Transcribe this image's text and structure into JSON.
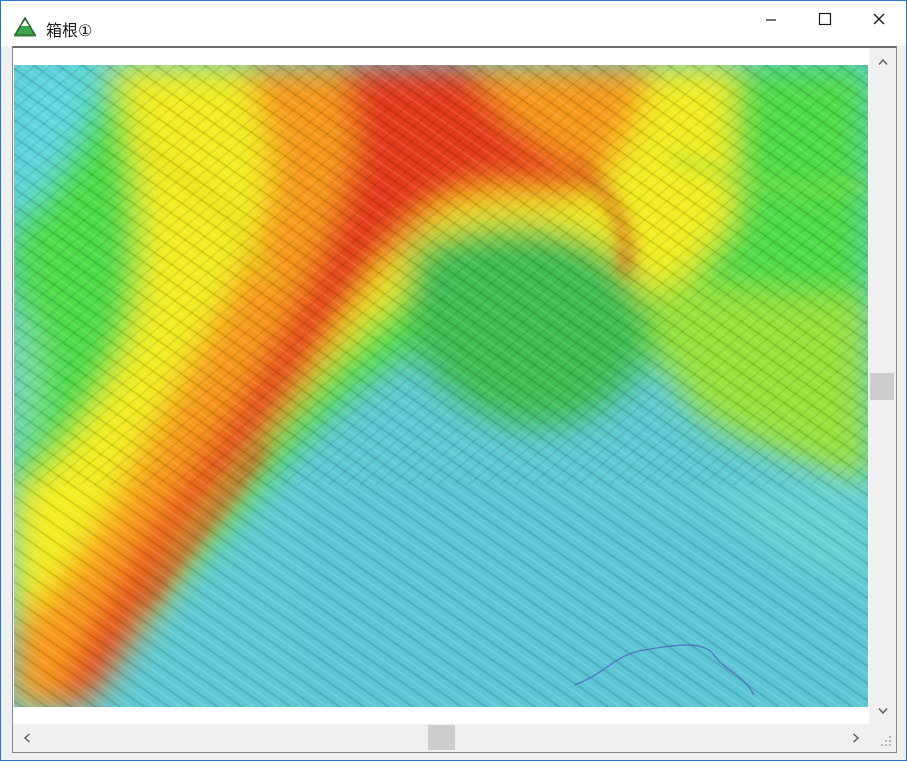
{
  "window": {
    "title": "箱根①",
    "icon": "mountain-app-icon",
    "controls": {
      "minimize": "minimize-icon",
      "maximize": "maximize-icon",
      "close": "close-icon"
    }
  },
  "map": {
    "description_icon": "relief-map",
    "colors": {
      "high": "#e23b1a",
      "mid_high": "#f7a21c",
      "mid": "#f2f21e",
      "mid_low": "#55e13a",
      "low": "#5fcfd6",
      "lowest": "#55b8e6"
    }
  },
  "scrollbars": {
    "vertical": {
      "up_icon": "chevron-up-icon",
      "down_icon": "chevron-down-icon",
      "position": 0.5
    },
    "horizontal": {
      "left_icon": "chevron-left-icon",
      "right_icon": "chevron-right-icon",
      "position": 0.5
    }
  }
}
